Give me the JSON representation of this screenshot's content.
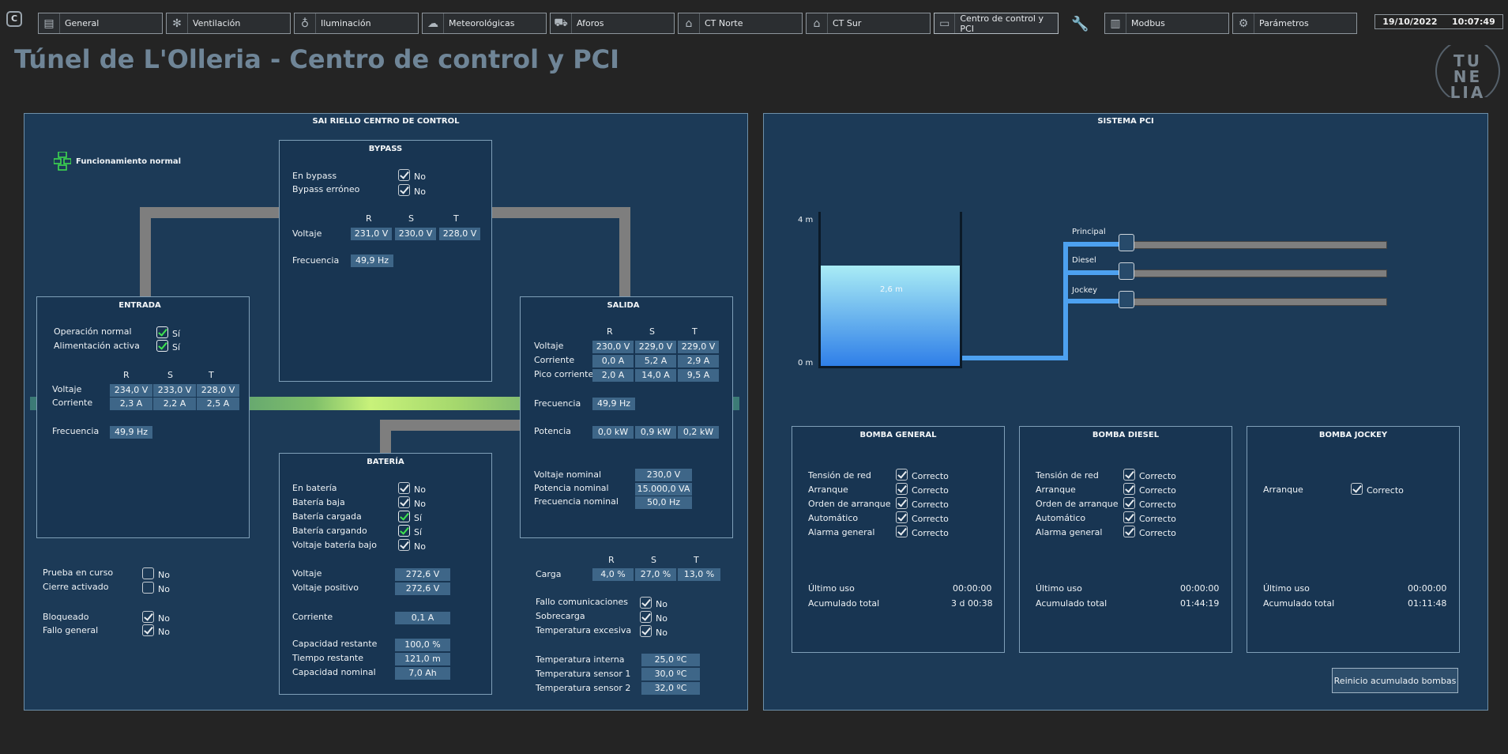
{
  "nav": {
    "tabs": [
      {
        "label": "General",
        "icon": "dashboard-icon"
      },
      {
        "label": "Ventilación",
        "icon": "fan-icon"
      },
      {
        "label": "Iluminación",
        "icon": "lightbulb-icon"
      },
      {
        "label": "Meteorológicas",
        "icon": "cloud-icon"
      },
      {
        "label": "Aforos",
        "icon": "car-icon"
      },
      {
        "label": "CT Norte",
        "icon": "house-up-icon"
      },
      {
        "label": "CT Sur",
        "icon": "house-down-icon"
      },
      {
        "label": "Centro de control y PCI",
        "icon": "control-center-icon"
      },
      {
        "label": "Modbus",
        "icon": "server-icon"
      },
      {
        "label": "Parámetros",
        "icon": "gear-icon"
      }
    ],
    "date": "19/10/2022",
    "time": "10:07:49"
  },
  "page_title": "Túnel de L'Olleria - Centro de control y PCI",
  "logo_text": "TUNELIA",
  "sai": {
    "title": "SAI RIELLO CENTRO DE CONTROL",
    "status": "Funcionamiento normal",
    "bypass": {
      "title": "BYPASS",
      "en_bypass_label": "En bypass",
      "en_bypass_val": "No",
      "erroneo_label": "Bypass erróneo",
      "erroneo_val": "No",
      "r": "R",
      "s": "S",
      "t": "T",
      "voltaje_label": "Voltaje",
      "voltaje": [
        "231,0 V",
        "230,0 V",
        "228,0 V"
      ],
      "frecuencia_label": "Frecuencia",
      "frecuencia": "49,9 Hz"
    },
    "entrada": {
      "title": "ENTRADA",
      "op_label": "Operación normal",
      "op_val": "Sí",
      "alim_label": "Alimentación activa",
      "alim_val": "Sí",
      "r": "R",
      "s": "S",
      "t": "T",
      "voltaje_label": "Voltaje",
      "voltaje": [
        "234,0 V",
        "233,0 V",
        "228,0 V"
      ],
      "corriente_label": "Corriente",
      "corriente": [
        "2,3 A",
        "2,2 A",
        "2,5 A"
      ],
      "frecuencia_label": "Frecuencia",
      "frecuencia": "49,9 Hz"
    },
    "salida": {
      "title": "SALIDA",
      "r": "R",
      "s": "S",
      "t": "T",
      "voltaje_label": "Voltaje",
      "voltaje": [
        "230,0 V",
        "229,0 V",
        "229,0 V"
      ],
      "corriente_label": "Corriente",
      "corriente": [
        "0,0 A",
        "5,2 A",
        "2,9 A"
      ],
      "pico_label": "Pico corriente",
      "pico": [
        "2,0 A",
        "14,0 A",
        "9,5 A"
      ],
      "frecuencia_label": "Frecuencia",
      "frecuencia": "49,9 Hz",
      "potencia_label": "Potencia",
      "potencia": [
        "0,0 kW",
        "0,9 kW",
        "0,2 kW"
      ],
      "vnom_label": "Voltaje nominal",
      "vnom": "230,0 V",
      "pnom_label": "Potencia nominal",
      "pnom": "15.000,0 VA",
      "fnom_label": "Frecuencia nominal",
      "fnom": "50,0 Hz"
    },
    "bateria": {
      "title": "BATERÍA",
      "en_bat_label": "En batería",
      "en_bat_val": "No",
      "baja_label": "Batería  baja",
      "baja_val": "No",
      "cargada_label": "Batería cargada",
      "cargada_val": "Sí",
      "cargando_label": "Batería cargando",
      "cargando_val": "Sí",
      "vbajo_label": "Voltaje batería bajo",
      "vbajo_val": "No",
      "voltaje_label": "Voltaje",
      "voltaje": "272,6 V",
      "vpos_label": "Voltaje positivo",
      "vpos": "272,6 V",
      "corriente_label": "Corriente",
      "corriente": "0,1 A",
      "cap_rest_label": "Capacidad restante",
      "cap_rest": "100,0 %",
      "tiempo_label": "Tiempo restante",
      "tiempo": "121,0 m",
      "cap_nom_label": "Capacidad nominal",
      "cap_nom": "7,0 Ah"
    },
    "misc": {
      "prueba_label": "Prueba en curso",
      "prueba_val": "No",
      "cierre_label": "Cierre activado",
      "cierre_val": "No",
      "bloqueado_label": "Bloqueado",
      "bloqueado_val": "No",
      "fallo_label": "Fallo general",
      "fallo_val": "No"
    },
    "carga": {
      "r": "R",
      "s": "S",
      "t": "T",
      "label": "Carga",
      "values": [
        "4,0 %",
        "27,0 %",
        "13,0 %"
      ],
      "fallo_com_label": "Fallo comunicaciones",
      "fallo_com_val": "No",
      "sobrecarga_label": "Sobrecarga",
      "sobrecarga_val": "No",
      "temp_exc_label": "Temperatura excesiva",
      "temp_exc_val": "No",
      "temp_int_label": "Temperatura interna",
      "temp_int": "25,0 ºC",
      "temp_s1_label": "Temperatura sensor 1",
      "temp_s1": "30,0 ºC",
      "temp_s2_label": "Temperatura sensor 2",
      "temp_s2": "32,0 ºC"
    }
  },
  "pci": {
    "title": "SISTEMA PCI",
    "tank_top": "4 m",
    "tank_bottom": "0 m",
    "level": "2,6 m",
    "level_fraction": 0.65,
    "pumps": [
      "Principal",
      "Diesel",
      "Jockey"
    ],
    "general": {
      "title": "BOMBA GENERAL",
      "rows": [
        {
          "label": "Tensión de red",
          "val": "Correcto"
        },
        {
          "label": "Arranque",
          "val": "Correcto"
        },
        {
          "label": "Orden de arranque",
          "val": "Correcto"
        },
        {
          "label": "Automático",
          "val": "Correcto"
        },
        {
          "label": "Alarma general",
          "val": "Correcto"
        }
      ],
      "ultimo_label": "Último uso",
      "ultimo": "00:00:00",
      "acum_label": "Acumulado total",
      "acum": "3 d 00:38"
    },
    "diesel": {
      "title": "BOMBA DIESEL",
      "rows": [
        {
          "label": "Tensión de red",
          "val": "Correcto"
        },
        {
          "label": "Arranque",
          "val": "Correcto"
        },
        {
          "label": "Orden de arranque",
          "val": "Correcto"
        },
        {
          "label": "Automático",
          "val": "Correcto"
        },
        {
          "label": "Alarma general",
          "val": "Correcto"
        }
      ],
      "ultimo_label": "Último uso",
      "ultimo": "00:00:00",
      "acum_label": "Acumulado total",
      "acum": "01:44:19"
    },
    "jockey": {
      "title": "BOMBA JOCKEY",
      "arranque_label": "Arranque",
      "arranque_val": "Correcto",
      "ultimo_label": "Último uso",
      "ultimo": "00:00:00",
      "acum_label": "Acumulado total",
      "acum": "01:11:48"
    },
    "reset_button": "Reinicio acumulado bombas"
  },
  "colors": {
    "panel": "#1c3a57",
    "value_bg": "#3e6688",
    "water_top": "#a9ecf5",
    "water_bottom": "#2f7fe8",
    "pipe_blue": "#4da1f0"
  }
}
